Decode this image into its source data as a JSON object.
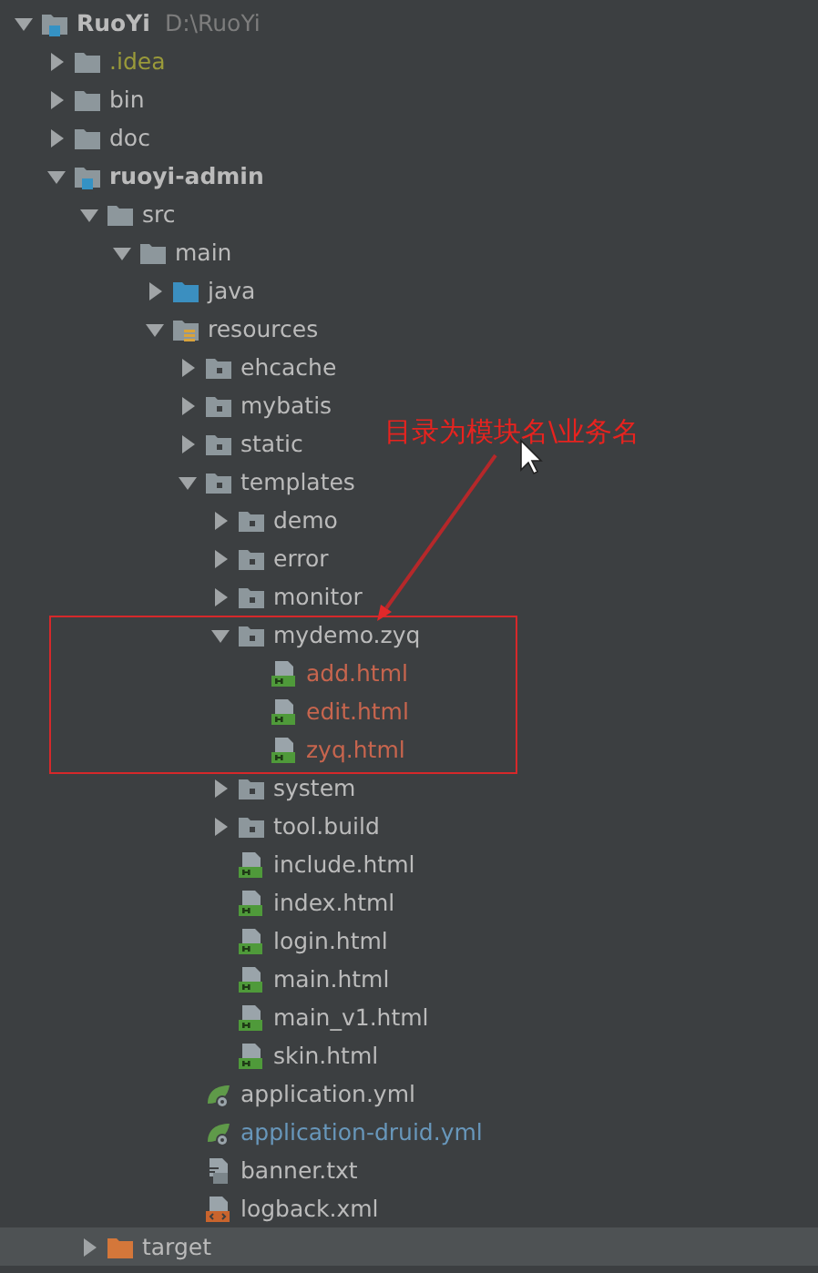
{
  "project_tree": {
    "items": [
      {
        "label": "RuoYi",
        "path": "D:\\RuoYi",
        "kind": "module",
        "expanded": true,
        "selected": false,
        "color": "#bbbbbb",
        "children": [
          {
            "label": ".idea",
            "kind": "folder",
            "expanded": false,
            "selected": false,
            "color": "#9a9a3a"
          },
          {
            "label": "bin",
            "kind": "folder",
            "expanded": false,
            "selected": false,
            "color": "#bbbbbb"
          },
          {
            "label": "doc",
            "kind": "folder",
            "expanded": false,
            "selected": false,
            "color": "#bbbbbb"
          },
          {
            "label": "ruoyi-admin",
            "kind": "module",
            "expanded": true,
            "selected": false,
            "color": "#bbbbbb",
            "children": [
              {
                "label": "src",
                "kind": "folder",
                "expanded": true,
                "selected": false,
                "color": "#bbbbbb",
                "children": [
                  {
                    "label": "main",
                    "kind": "folder",
                    "expanded": true,
                    "selected": false,
                    "color": "#bbbbbb",
                    "children": [
                      {
                        "label": "java",
                        "kind": "source",
                        "expanded": false,
                        "selected": false,
                        "color": "#bbbbbb"
                      },
                      {
                        "label": "resources",
                        "kind": "resource",
                        "expanded": true,
                        "selected": false,
                        "color": "#bbbbbb",
                        "children": [
                          {
                            "label": "ehcache",
                            "kind": "package",
                            "expanded": false,
                            "selected": false,
                            "color": "#bbbbbb"
                          },
                          {
                            "label": "mybatis",
                            "kind": "package",
                            "expanded": false,
                            "selected": false,
                            "color": "#bbbbbb"
                          },
                          {
                            "label": "static",
                            "kind": "package",
                            "expanded": false,
                            "selected": false,
                            "color": "#bbbbbb"
                          },
                          {
                            "label": "templates",
                            "kind": "package",
                            "expanded": true,
                            "selected": false,
                            "color": "#bbbbbb",
                            "children": [
                              {
                                "label": "demo",
                                "kind": "package",
                                "expanded": false,
                                "selected": false,
                                "color": "#bbbbbb"
                              },
                              {
                                "label": "error",
                                "kind": "package",
                                "expanded": false,
                                "selected": false,
                                "color": "#bbbbbb"
                              },
                              {
                                "label": "monitor",
                                "kind": "package",
                                "expanded": false,
                                "selected": false,
                                "color": "#bbbbbb"
                              },
                              {
                                "label": "mydemo.zyq",
                                "kind": "package",
                                "expanded": true,
                                "selected": false,
                                "color": "#bbbbbb",
                                "children": [
                                  {
                                    "label": "add.html",
                                    "kind": "html",
                                    "selected": false,
                                    "color": "#c7654e"
                                  },
                                  {
                                    "label": "edit.html",
                                    "kind": "html",
                                    "selected": false,
                                    "color": "#c7654e"
                                  },
                                  {
                                    "label": "zyq.html",
                                    "kind": "html",
                                    "selected": false,
                                    "color": "#c7654e"
                                  }
                                ]
                              },
                              {
                                "label": "system",
                                "kind": "package",
                                "expanded": false,
                                "selected": false,
                                "color": "#bbbbbb"
                              },
                              {
                                "label": "tool.build",
                                "kind": "package",
                                "expanded": false,
                                "selected": false,
                                "color": "#bbbbbb"
                              },
                              {
                                "label": "include.html",
                                "kind": "html",
                                "selected": false,
                                "color": "#bbbbbb"
                              },
                              {
                                "label": "index.html",
                                "kind": "html",
                                "selected": false,
                                "color": "#bbbbbb"
                              },
                              {
                                "label": "login.html",
                                "kind": "html",
                                "selected": false,
                                "color": "#bbbbbb"
                              },
                              {
                                "label": "main.html",
                                "kind": "html",
                                "selected": false,
                                "color": "#bbbbbb"
                              },
                              {
                                "label": "main_v1.html",
                                "kind": "html",
                                "selected": false,
                                "color": "#bbbbbb"
                              },
                              {
                                "label": "skin.html",
                                "kind": "html",
                                "selected": false,
                                "color": "#bbbbbb"
                              }
                            ]
                          },
                          {
                            "label": "application.yml",
                            "kind": "yml",
                            "selected": false,
                            "color": "#bbbbbb"
                          },
                          {
                            "label": "application-druid.yml",
                            "kind": "yml",
                            "selected": false,
                            "color": "#6897bb"
                          },
                          {
                            "label": "banner.txt",
                            "kind": "txt",
                            "selected": false,
                            "color": "#bbbbbb"
                          },
                          {
                            "label": "logback.xml",
                            "kind": "xml",
                            "selected": false,
                            "color": "#bbbbbb"
                          }
                        ]
                      }
                    ]
                  }
                ]
              },
              {
                "label": "target",
                "kind": "excluded",
                "expanded": false,
                "selected": true,
                "color": "#bbbbbb"
              }
            ]
          }
        ]
      }
    ]
  },
  "annotation": {
    "label": "目录为模块名\\业务名"
  }
}
